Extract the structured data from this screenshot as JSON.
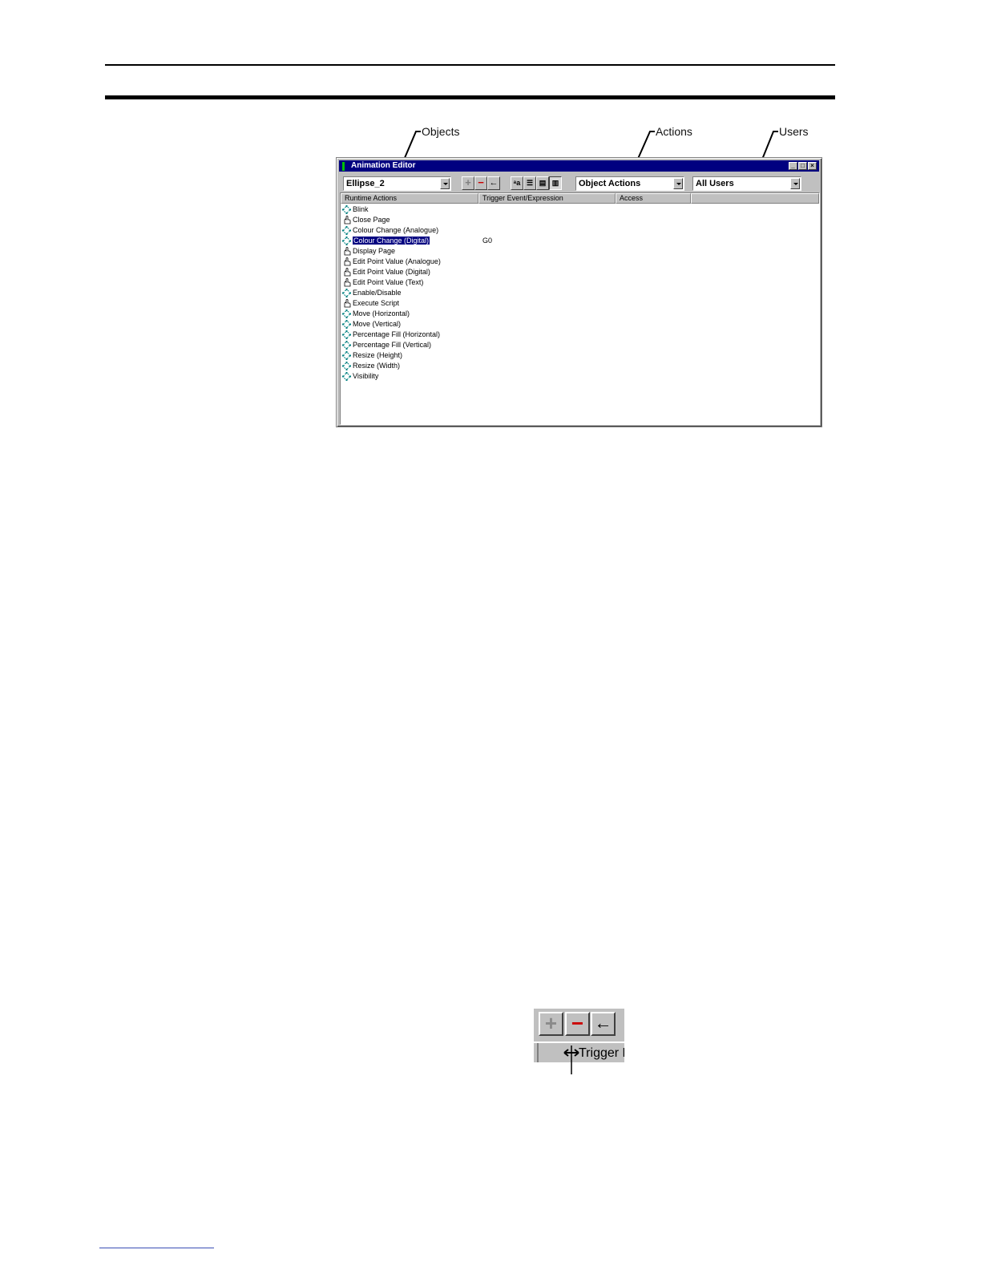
{
  "callouts": {
    "objects": "Objects",
    "actions": "Actions",
    "users": "Users"
  },
  "window": {
    "title": "Animation Editor",
    "object_select": "Ellipse_2",
    "actions_select": "Object Actions",
    "users_select": "All Users",
    "columns": [
      "Runtime Actions",
      "Trigger Event/Expression",
      "Access",
      ""
    ],
    "rows": [
      {
        "label": "Blink",
        "icon": "animate-icon",
        "trigger": ""
      },
      {
        "label": "Close Page",
        "icon": "hand-pointer-icon",
        "trigger": ""
      },
      {
        "label": "Colour Change (Analogue)",
        "icon": "animate-icon",
        "trigger": ""
      },
      {
        "label": "Colour Change (Digital)",
        "icon": "animate-icon",
        "trigger": "G0",
        "selected": true
      },
      {
        "label": "Display Page",
        "icon": "hand-pointer-icon",
        "trigger": ""
      },
      {
        "label": "Edit Point Value (Analogue)",
        "icon": "hand-pointer-icon",
        "trigger": ""
      },
      {
        "label": "Edit Point Value (Digital)",
        "icon": "hand-pointer-icon",
        "trigger": ""
      },
      {
        "label": "Edit Point Value (Text)",
        "icon": "hand-pointer-icon",
        "trigger": ""
      },
      {
        "label": "Enable/Disable",
        "icon": "animate-icon",
        "trigger": ""
      },
      {
        "label": "Execute Script",
        "icon": "hand-pointer-icon",
        "trigger": ""
      },
      {
        "label": "Move (Horizontal)",
        "icon": "animate-icon",
        "trigger": ""
      },
      {
        "label": "Move (Vertical)",
        "icon": "animate-icon",
        "trigger": ""
      },
      {
        "label": "Percentage Fill (Horizontal)",
        "icon": "animate-icon",
        "trigger": ""
      },
      {
        "label": "Percentage Fill (Vertical)",
        "icon": "animate-icon",
        "trigger": ""
      },
      {
        "label": "Resize (Height)",
        "icon": "animate-icon",
        "trigger": ""
      },
      {
        "label": "Resize (Width)",
        "icon": "animate-icon",
        "trigger": ""
      },
      {
        "label": "Visibility",
        "icon": "animate-icon",
        "trigger": ""
      }
    ]
  },
  "zoom_detail": {
    "header_text": "Trigger E"
  },
  "colors": {
    "title_bar": "#000080",
    "selection": "#000080",
    "minus": "#cc0000",
    "face": "#c0c0c0"
  }
}
